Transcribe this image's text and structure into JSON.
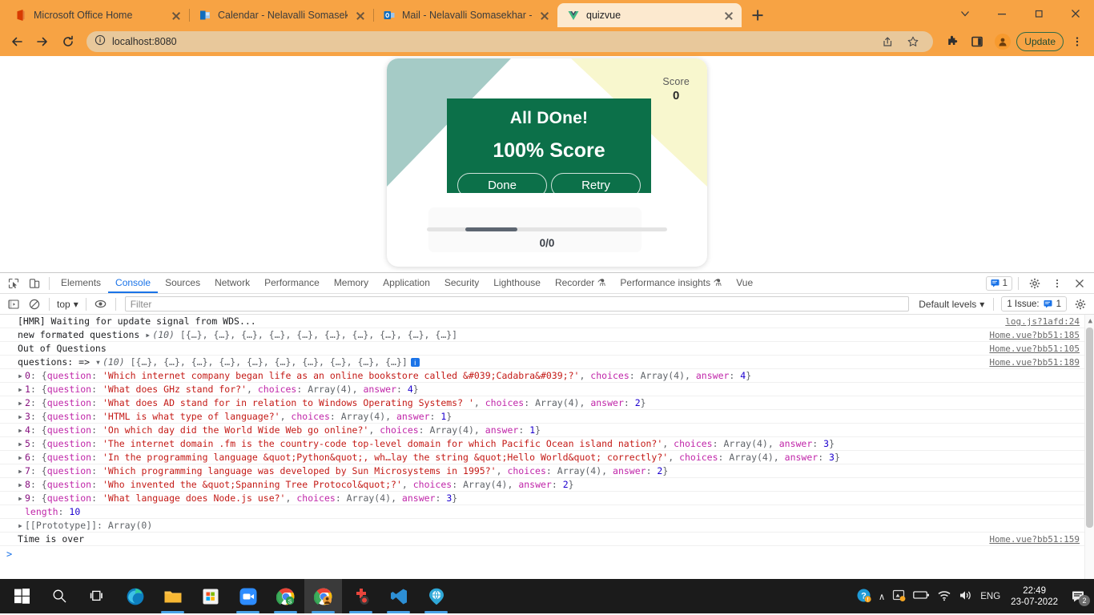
{
  "browser": {
    "tabs": [
      {
        "title": "Microsoft Office Home",
        "favicon": "office-icon",
        "active": false
      },
      {
        "title": "Calendar - Nelavalli Somasekhar",
        "favicon": "outlook-calendar-icon",
        "active": false
      },
      {
        "title": "Mail - Nelavalli Somasekhar - Ou",
        "favicon": "outlook-mail-icon",
        "active": false
      },
      {
        "title": "quizvue",
        "favicon": "vue-icon",
        "active": true
      }
    ],
    "new_tab_label": "+",
    "window_controls": {
      "list": "∨",
      "minimize": "─",
      "maximize": "❐",
      "close": "✕"
    },
    "toolbar": {
      "back": "←",
      "forward": "→",
      "reload": "↻",
      "site_info": "info-icon",
      "url": "localhost:8080",
      "share": "share-icon",
      "bookmark": "star-icon",
      "extensions": "puzzle-icon",
      "sidepanel": "sidepanel-icon",
      "profile": "avatar-icon",
      "update_label": "Update",
      "menu": "⋮"
    }
  },
  "page": {
    "card": {
      "score_label": "Score",
      "score_value": "0",
      "progress_text": "0/0"
    },
    "overlay": {
      "title": "All DOne!",
      "score_text": "100% Score",
      "done_label": "Done",
      "retry_label": "Retry"
    },
    "colors": {
      "overlay_green": "#0c7049",
      "corner_teal": "#a5cbc6",
      "corner_yellow": "#f8f7ce"
    }
  },
  "devtools": {
    "tabs": [
      "Elements",
      "Console",
      "Sources",
      "Network",
      "Performance",
      "Memory",
      "Application",
      "Security",
      "Lighthouse",
      "Recorder",
      "Performance insights",
      "Vue"
    ],
    "active_tab": "Console",
    "experimental_marker": "⚗",
    "message_badge_count": "1",
    "settings_icon": "gear-icon",
    "more_icon": "kebab-icon",
    "close_icon": "close-icon",
    "filterbar": {
      "sidebar_toggle": "console-sidebar-icon",
      "clear_icon": "clear-console-icon",
      "context": "top",
      "context_caret": "▾",
      "eye_icon": "live-expression-icon",
      "filter_placeholder": "Filter",
      "levels_label": "Default levels",
      "levels_caret": "▾",
      "issues_label": "1 Issue:",
      "issues_count": "1",
      "settings_icon": "gear-icon"
    },
    "console": {
      "lines": [
        {
          "type": "plain",
          "text": "[HMR] Waiting for update signal from WDS...",
          "source": "log.js?1afd:24"
        },
        {
          "type": "array_preview",
          "label": "new formated questions",
          "count": "(10)",
          "preview": "[{…}, {…}, {…}, {…}, {…}, {…}, {…}, {…}, {…}, {…}]",
          "source": "Home.vue?bb51:185"
        },
        {
          "type": "plain",
          "text": "Out of Questions",
          "source": "Home.vue?bb51:105"
        },
        {
          "type": "array_expanded",
          "label": "questions: =>",
          "count": "(10)",
          "preview": "[{…}, {…}, {…}, {…}, {…}, {…}, {…}, {…}, {…}, {…}]",
          "info_badge": "i",
          "source": "Home.vue?bb51:189"
        }
      ],
      "questions": [
        {
          "index": "0",
          "question": "Which internet company began life as an online bookstore called &#039;Cadabra&#039;?",
          "choices": "Array(4)",
          "answer": "4"
        },
        {
          "index": "1",
          "question": "What does GHz stand for?",
          "choices": "Array(4)",
          "answer": "4"
        },
        {
          "index": "2",
          "question": "What does AD stand for in relation to Windows Operating Systems? ",
          "choices": "Array(4)",
          "answer": "2"
        },
        {
          "index": "3",
          "question": "HTML is what type of language?",
          "choices": "Array(4)",
          "answer": "1"
        },
        {
          "index": "4",
          "question": "On which day did the World Wide Web go online?",
          "choices": "Array(4)",
          "answer": "1"
        },
        {
          "index": "5",
          "question": "The internet domain .fm is the country-code top-level domain for which Pacific Ocean island nation?",
          "choices": "Array(4)",
          "answer": "3"
        },
        {
          "index": "6",
          "question": "In the programming language &quot;Python&quot;, wh…lay the string &quot;Hello World&quot; correctly?",
          "choices": "Array(4)",
          "answer": "3"
        },
        {
          "index": "7",
          "question": "Which programming language was developed by Sun Microsystems in 1995?",
          "choices": "Array(4)",
          "answer": "2"
        },
        {
          "index": "8",
          "question": "Who invented the &quot;Spanning Tree Protocol&quot;?",
          "choices": "Array(4)",
          "answer": "2"
        },
        {
          "index": "9",
          "question": "What language does Node.js use?",
          "choices": "Array(4)",
          "answer": "3"
        }
      ],
      "length_key": "length",
      "length_value": "10",
      "prototype_text": "[[Prototype]]: Array(0)",
      "final_line": {
        "text": "Time is over",
        "source": "Home.vue?bb51:159"
      },
      "prompt": ">"
    }
  },
  "taskbar": {
    "items": [
      {
        "name": "start-button",
        "icon": "windows-icon"
      },
      {
        "name": "search-button",
        "icon": "search-icon"
      },
      {
        "name": "task-view-button",
        "icon": "task-view-icon"
      },
      {
        "name": "edge-button",
        "icon": "edge-icon"
      },
      {
        "name": "file-explorer-button",
        "icon": "folder-icon"
      },
      {
        "name": "microsoft-store-button",
        "icon": "store-icon"
      },
      {
        "name": "zoom-button",
        "icon": "zoom-camera-icon"
      },
      {
        "name": "chrome-profile-s-button",
        "icon": "chrome-icon"
      },
      {
        "name": "chrome-button",
        "icon": "chrome-icon"
      },
      {
        "name": "screen-recorder-button",
        "icon": "record-icon"
      },
      {
        "name": "vscode-button",
        "icon": "vscode-icon"
      },
      {
        "name": "app-button",
        "icon": "globe-pin-icon"
      }
    ],
    "tray": {
      "help_icon": "help-icon",
      "chevron_up": "∧",
      "onedrive_icon": "onedrive-icon",
      "battery_icon": "battery-icon",
      "wifi_icon": "wifi-icon",
      "volume_icon": "volume-icon",
      "language": "ENG",
      "time": "22:49",
      "date": "23-07-2022",
      "notification_icon": "notification-icon",
      "notification_count": "2"
    }
  }
}
